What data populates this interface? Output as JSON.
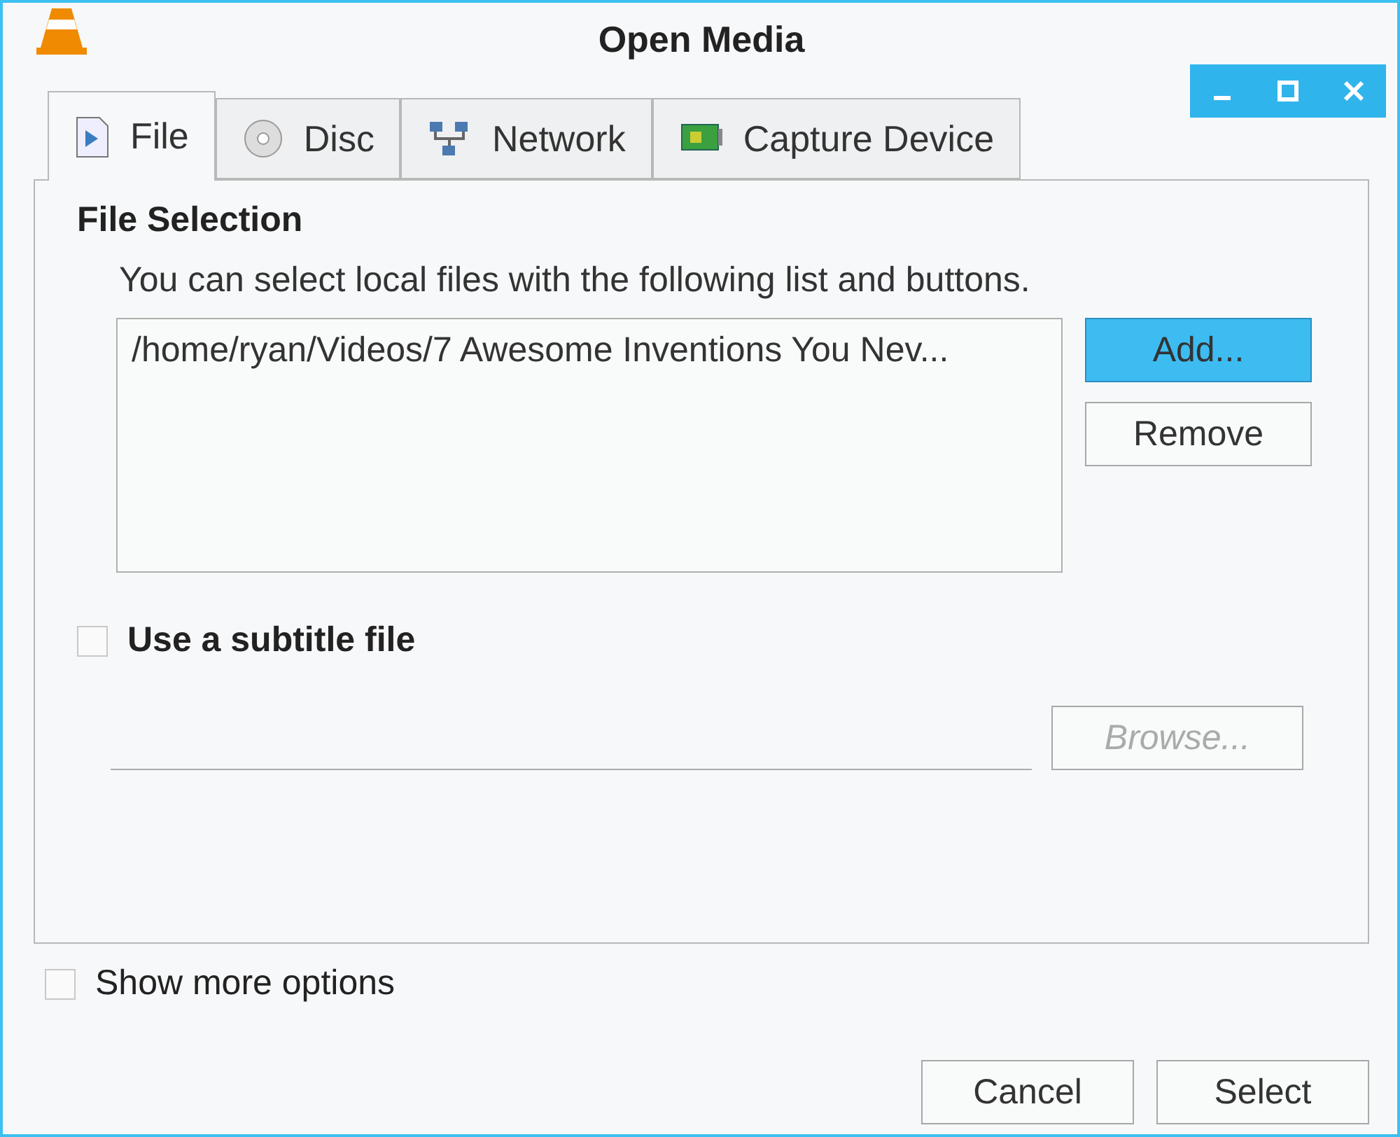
{
  "window": {
    "title": "Open Media"
  },
  "tabs": [
    {
      "label": "File",
      "kind": "file",
      "selected": true
    },
    {
      "label": "Disc",
      "kind": "disc",
      "selected": false
    },
    {
      "label": "Network",
      "kind": "network",
      "selected": false
    },
    {
      "label": "Capture Device",
      "kind": "capture",
      "selected": false
    }
  ],
  "file_selection": {
    "title": "File Selection",
    "hint": "You can select local files with the following list and buttons.",
    "files": [
      "/home/ryan/Videos/7 Awesome Inventions You Nev..."
    ],
    "buttons": [
      {
        "label": "Add...",
        "highlighted": true,
        "disabled": false
      },
      {
        "label": "Remove",
        "highlighted": false,
        "disabled": false
      }
    ]
  },
  "subtitle": {
    "label": "Use a subtitle file",
    "checked": false,
    "field_disabled": true,
    "browse": {
      "label": "Browse...",
      "disabled": true
    }
  },
  "more_options": {
    "label": "Show more options",
    "checked": false
  },
  "footer_buttons": [
    {
      "label": "Cancel",
      "highlighted": false,
      "disabled": false
    },
    {
      "label": "Select",
      "highlighted": false,
      "disabled": false
    }
  ]
}
